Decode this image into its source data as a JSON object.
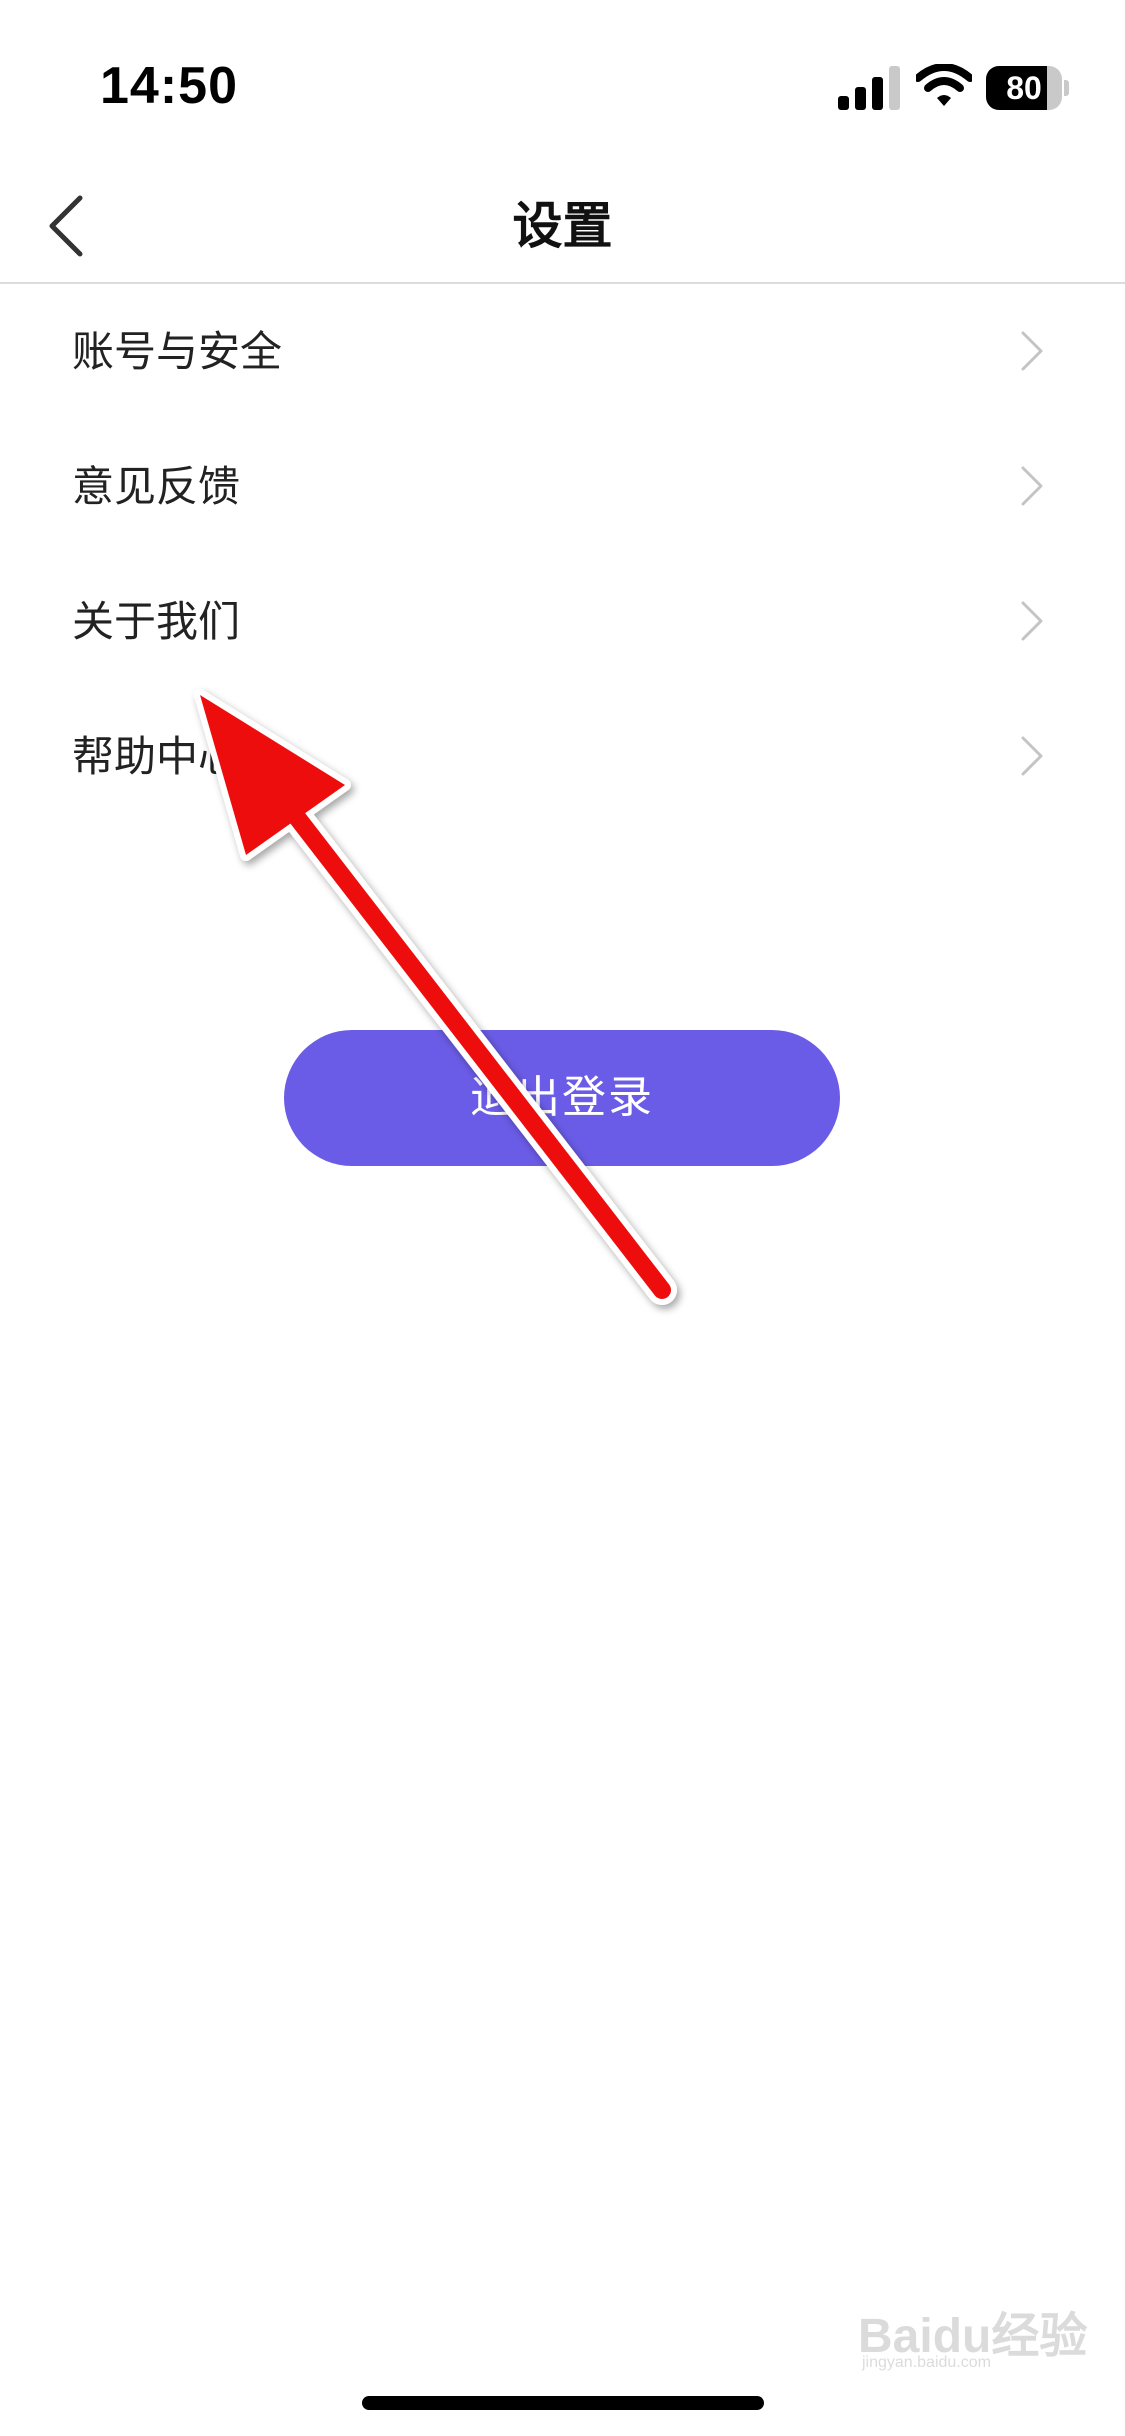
{
  "status_bar": {
    "time": "14:50",
    "battery_level": "80",
    "battery_fraction": 0.8,
    "icons": [
      "signal-icon",
      "wifi-icon",
      "battery-icon"
    ]
  },
  "nav": {
    "title": "设置",
    "back_icon": "chevron-left-icon"
  },
  "menu": {
    "items": [
      {
        "label": "账号与安全",
        "icon": "chevron-right-icon"
      },
      {
        "label": "意见反馈",
        "icon": "chevron-right-icon"
      },
      {
        "label": "关于我们",
        "icon": "chevron-right-icon"
      },
      {
        "label": "帮助中心",
        "icon": "chevron-right-icon"
      }
    ]
  },
  "logout": {
    "label": "退出登录",
    "color": "#6b5ce7"
  },
  "annotation": {
    "arrow_color": "#ee1111",
    "points_to": "帮助中心"
  },
  "watermark": {
    "text": "Baidu经验",
    "subtext": "jingyan.baidu.com"
  }
}
